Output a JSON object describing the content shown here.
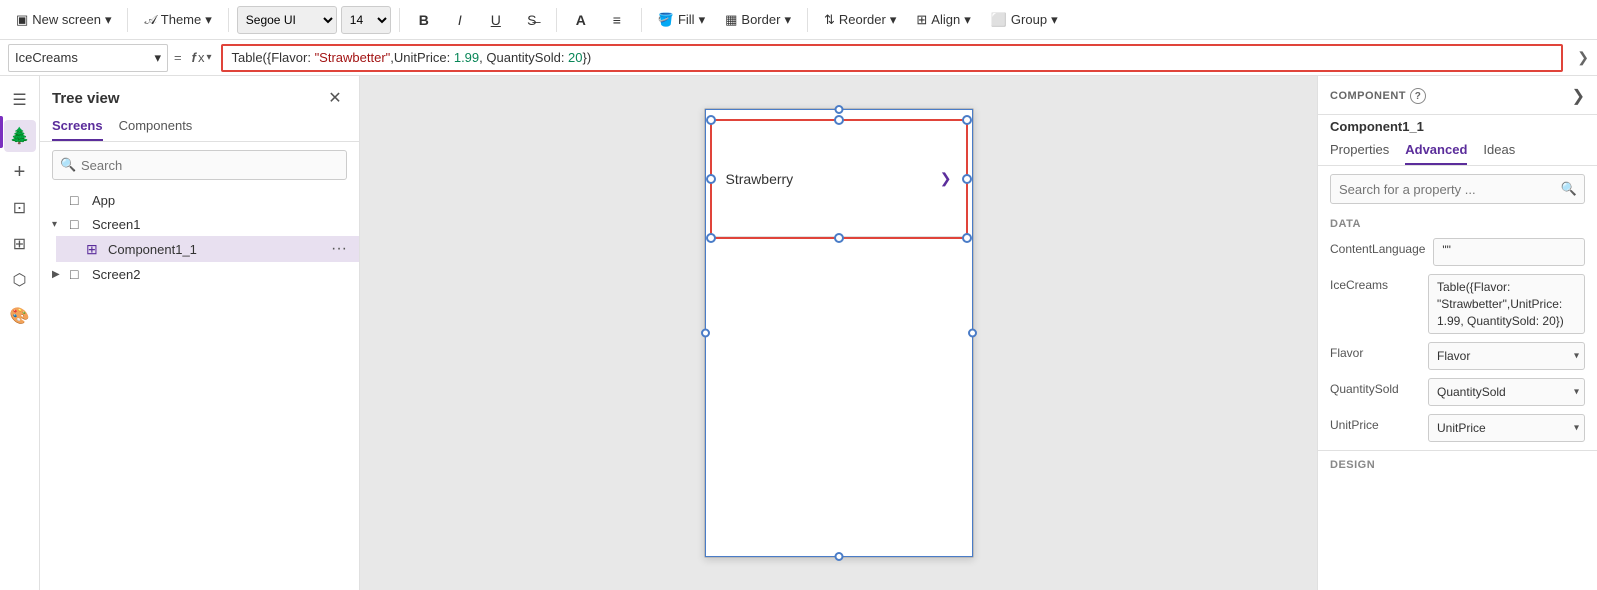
{
  "toolbar": {
    "new_screen_label": "New screen",
    "theme_label": "Theme",
    "bold_icon": "B",
    "italic_icon": "I",
    "underline_icon": "U",
    "strikethrough_icon": "—",
    "font_icon": "A",
    "align_icon": "≡",
    "fill_label": "Fill",
    "border_label": "Border",
    "reorder_label": "Reorder",
    "align_label": "Align",
    "group_label": "Group"
  },
  "formula_bar": {
    "dropdown_value": "IceCreams",
    "eq_sign": "=",
    "fx_label": "fx",
    "formula_text": "Table({Flavor: \"Strawbetter\",UnitPrice: 1.99, QuantitySold: 20})",
    "chevron_icon": "❯"
  },
  "tree_panel": {
    "title": "Tree view",
    "tabs": [
      "Screens",
      "Components"
    ],
    "active_tab": "Screens",
    "search_placeholder": "Search",
    "items": [
      {
        "type": "app",
        "label": "App",
        "icon": "□",
        "indent": 0
      },
      {
        "type": "screen",
        "label": "Screen1",
        "icon": "□",
        "indent": 0,
        "expanded": true
      },
      {
        "type": "component",
        "label": "Component1_1",
        "icon": "⊞",
        "indent": 1,
        "selected": true
      },
      {
        "type": "screen",
        "label": "Screen2",
        "icon": "□",
        "indent": 0,
        "expanded": false
      }
    ]
  },
  "canvas": {
    "gallery_item_text": "Strawberry",
    "chevron_icon": "❯"
  },
  "right_panel": {
    "component_section_label": "COMPONENT",
    "component_name": "Component1_1",
    "help_icon": "?",
    "expand_icon": "❯",
    "tabs": [
      "Properties",
      "Advanced",
      "Ideas"
    ],
    "active_tab": "Advanced",
    "search_placeholder": "Search for a property ...",
    "sections": {
      "data": {
        "label": "DATA",
        "fields": [
          {
            "label": "ContentLanguage",
            "value": "\"\"",
            "type": "text"
          },
          {
            "label": "IceCreams",
            "value": "Table({Flavor:\n\"Strawbetter\",UnitPrice: 1.99,\nQuantitySold: 20})",
            "type": "multiline"
          },
          {
            "label": "Flavor",
            "value": "Flavor",
            "type": "select"
          },
          {
            "label": "QuantitySold",
            "value": "QuantitySold",
            "type": "select"
          },
          {
            "label": "UnitPrice",
            "value": "UnitPrice",
            "type": "select"
          }
        ]
      },
      "design": {
        "label": "DESIGN"
      }
    }
  }
}
